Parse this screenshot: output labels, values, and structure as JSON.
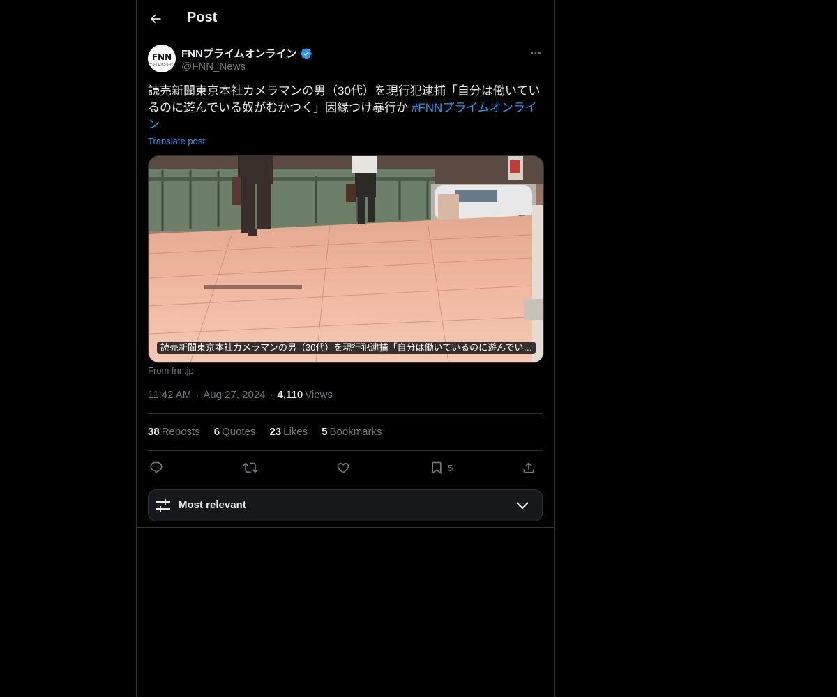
{
  "header": {
    "title": "Post",
    "back_icon": "arrow-left-icon"
  },
  "post": {
    "author": {
      "name": "FNNプライムオンライン",
      "handle": "@FNN_News",
      "verified": true,
      "avatar_text": "FNN",
      "avatar_subtext": "プライムオンライン"
    },
    "text_main": "読売新聞東京本社カメラマンの男（30代）を現行犯逮捕「自分は働いているのに遊んでいる奴がむかつく」因縁つけ暴行か ",
    "hashtag": "#FNNプライムオンライン",
    "translate_label": "Translate post",
    "card": {
      "caption": "読売新聞東京本社カメラマンの男（30代）を現行犯逮捕「自分は働いているのに遊んでい…",
      "source": "From fnn.jp"
    },
    "time": "11:42 AM",
    "date": "Aug 27, 2024",
    "views_count": "4,110",
    "views_label": "Views",
    "stats": [
      {
        "count": "38",
        "label": "Reposts"
      },
      {
        "count": "6",
        "label": "Quotes"
      },
      {
        "count": "23",
        "label": "Likes"
      },
      {
        "count": "5",
        "label": "Bookmarks"
      }
    ],
    "actions": {
      "reply_icon": "reply-icon",
      "repost_icon": "repost-icon",
      "like_icon": "heart-icon",
      "bookmark_icon": "bookmark-icon",
      "bookmark_count": "5",
      "share_icon": "share-icon"
    }
  },
  "sort": {
    "label": "Most relevant",
    "icon": "sliders-icon",
    "chevron": "chevron-down-icon"
  },
  "colors": {
    "accent": "#1d9bf0",
    "text": "#e7e9ea",
    "muted": "#71767b",
    "border": "#2f3336",
    "background": "#000000"
  }
}
